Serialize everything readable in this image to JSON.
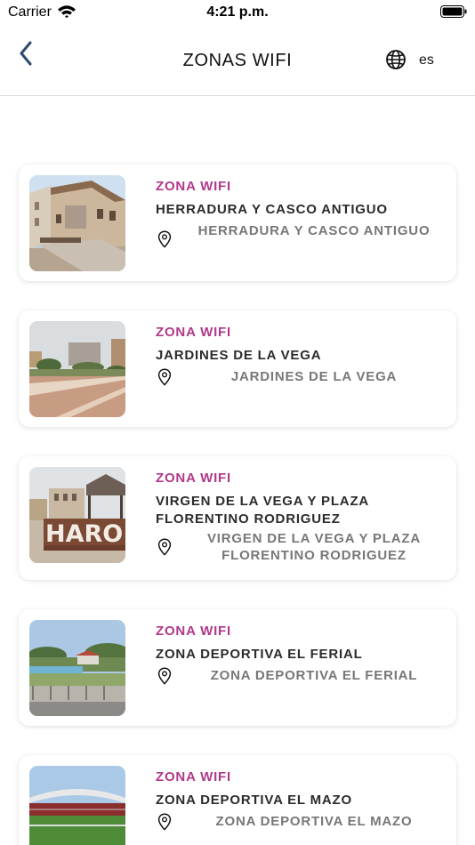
{
  "status_bar": {
    "carrier": "Carrier",
    "time": "4:21 p.m."
  },
  "nav": {
    "title": "ZONAS WIFI",
    "language": "es"
  },
  "colors": {
    "accent": "#b0388a",
    "title_text": "#2b2b2b",
    "address_text": "#777777"
  },
  "items": [
    {
      "tag": "ZONA WIFI",
      "name": "HERRADURA Y CASCO ANTIGUO",
      "address": "HERRADURA Y CASCO ANTIGUO"
    },
    {
      "tag": "ZONA WIFI",
      "name": "JARDINES DE LA VEGA",
      "address": "JARDINES DE LA VEGA"
    },
    {
      "tag": "ZONA WIFI",
      "name": "VIRGEN DE LA VEGA Y PLAZA FLORENTINO RODRIGUEZ",
      "address": "VIRGEN DE LA VEGA Y PLAZA FLORENTINO RODRIGUEZ",
      "photo_text": "HARO"
    },
    {
      "tag": "ZONA WIFI",
      "name": "ZONA DEPORTIVA EL FERIAL",
      "address": "ZONA DEPORTIVA EL FERIAL"
    },
    {
      "tag": "ZONA WIFI",
      "name": "ZONA DEPORTIVA EL MAZO",
      "address": "ZONA DEPORTIVA EL MAZO"
    }
  ]
}
